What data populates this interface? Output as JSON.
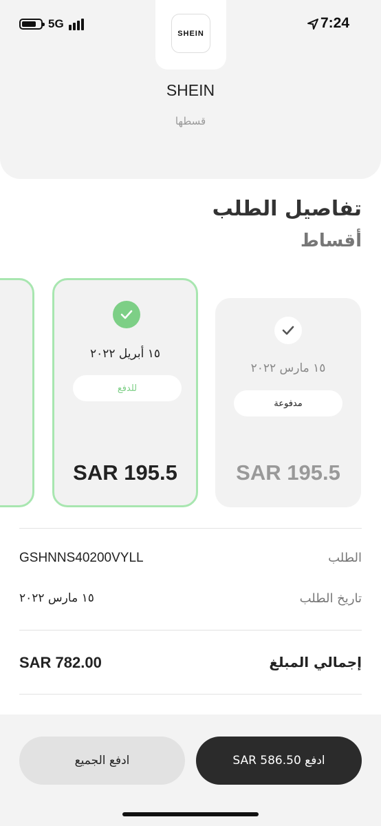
{
  "status_bar": {
    "network": "5G",
    "time": "7:24",
    "icons": [
      "battery-icon",
      "signal-icon",
      "location-arrow-icon"
    ]
  },
  "merchant": {
    "logo_text": "SHEIN",
    "name": "SHEIN",
    "subtitle": "قسطها"
  },
  "order": {
    "title": "تفاصيل الطلب",
    "subtitle": "أقساط",
    "installments": [
      {
        "date": "١٥ مارس ٢٠٢٢",
        "status": "مدفوعة",
        "amount": "SAR 195.5",
        "state": "paid"
      },
      {
        "date": "١٥ أبريل ٢٠٢٢",
        "status": "للدفع",
        "amount": "SAR 195.5",
        "state": "current"
      }
    ],
    "details": {
      "order_label": "الطلب",
      "order_value": "GSHNNS40200VYLL",
      "date_label": "تاريخ الطلب",
      "date_value": "١٥ مارس ٢٠٢٢",
      "total_label": "إجمالي المبلغ",
      "total_value": "SAR 782.00"
    }
  },
  "actions": {
    "pay_all_label": "ادفع الجميع",
    "pay_label": "ادفع SAR 586.50"
  },
  "colors": {
    "accent_green": "#7dcf86",
    "card_border_green": "#a8e6b0",
    "primary_button": "#2b2b2b",
    "secondary_button": "#e2e2e2"
  }
}
